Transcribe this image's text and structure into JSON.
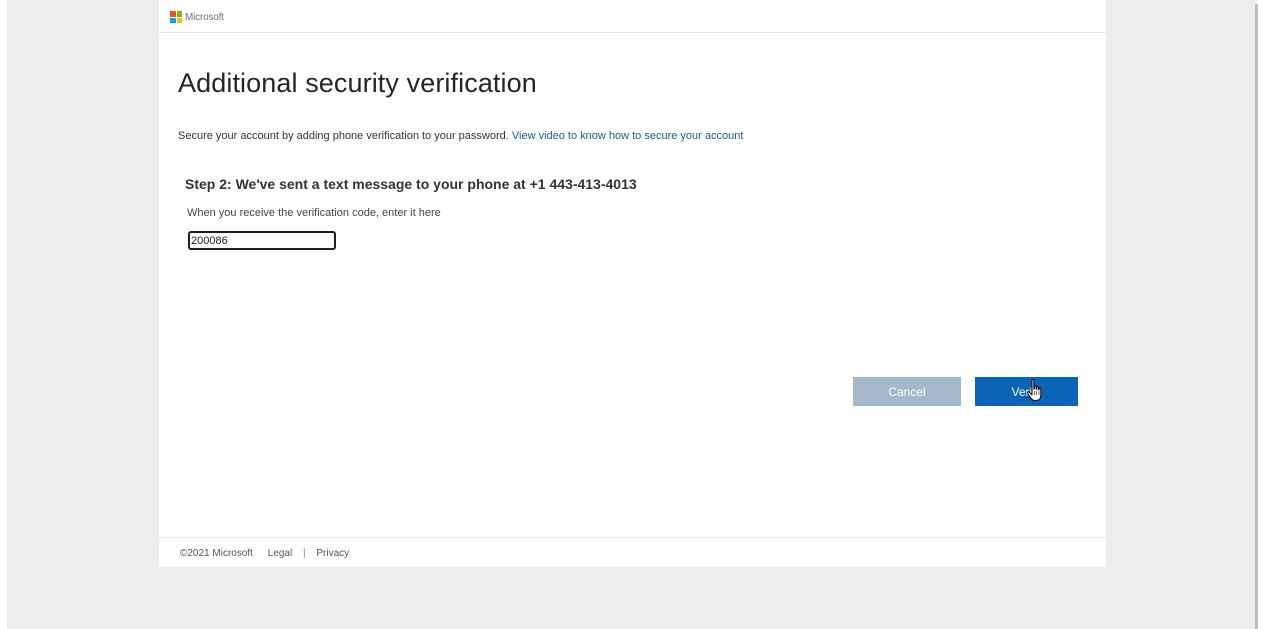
{
  "brand": {
    "name": "Microsoft",
    "logo_colors": [
      "#f25022",
      "#7fba00",
      "#00a4ef",
      "#ffb900"
    ]
  },
  "page": {
    "title": "Additional security verification",
    "intro_text": "Secure your account by adding phone verification to your password.",
    "intro_link": "View video to know how to secure your account"
  },
  "step": {
    "title": "Step 2: We've sent a text message to your phone at +1 443-413-4013",
    "code_label": "When you receive the verification code, enter it here",
    "code_value": "200086"
  },
  "actions": {
    "cancel_label": "Cancel",
    "verify_label": "Verify"
  },
  "footer": {
    "copyright": "©2021 Microsoft",
    "legal": "Legal",
    "separator": "|",
    "privacy": "Privacy"
  },
  "colors": {
    "primary_button": "#0b63b6",
    "disabled_button": "#a5b8cb",
    "link": "#1f5a96"
  },
  "cursor": {
    "icon": "hand-pointer-icon"
  }
}
